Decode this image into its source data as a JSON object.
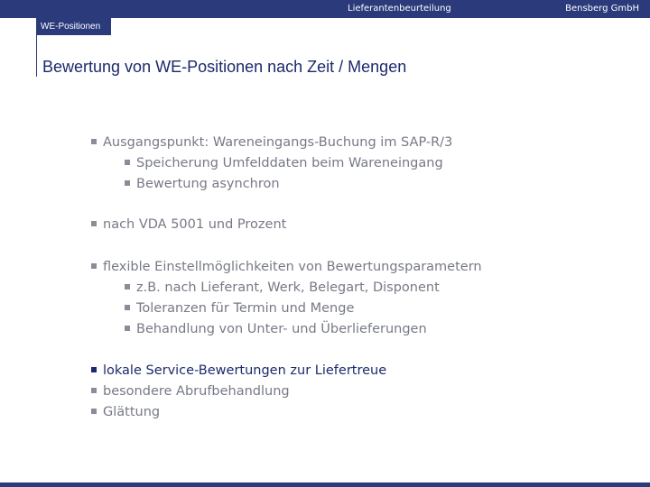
{
  "header": {
    "center_text": "Lieferantenbeurteilung",
    "right_text": "Bensberg GmbH"
  },
  "section_tab": "WE-Positionen",
  "title": "Bewertung von WE-Positionen nach Zeit / Mengen",
  "bullets": [
    {
      "text": "Ausgangspunkt: Wareneingangs-Buchung im SAP-R/3"
    },
    {
      "text": "Speicherung Umfelddaten beim Wareneingang"
    },
    {
      "text": "Bewertung asynchron"
    },
    {
      "text": "nach VDA 5001 und Prozent"
    },
    {
      "text": "flexible Einstellmöglichkeiten von Bewertungsparametern"
    },
    {
      "text": "z.B. nach Lieferant, Werk, Belegart, Disponent"
    },
    {
      "text": "Toleranzen für Termin und Menge"
    },
    {
      "text": "Behandlung von Unter- und Überlieferungen"
    },
    {
      "text": "lokale Service-Bewertungen zur Liefertreue"
    },
    {
      "text": "besondere Abrufbehandlung"
    },
    {
      "text": "Glättung"
    }
  ]
}
